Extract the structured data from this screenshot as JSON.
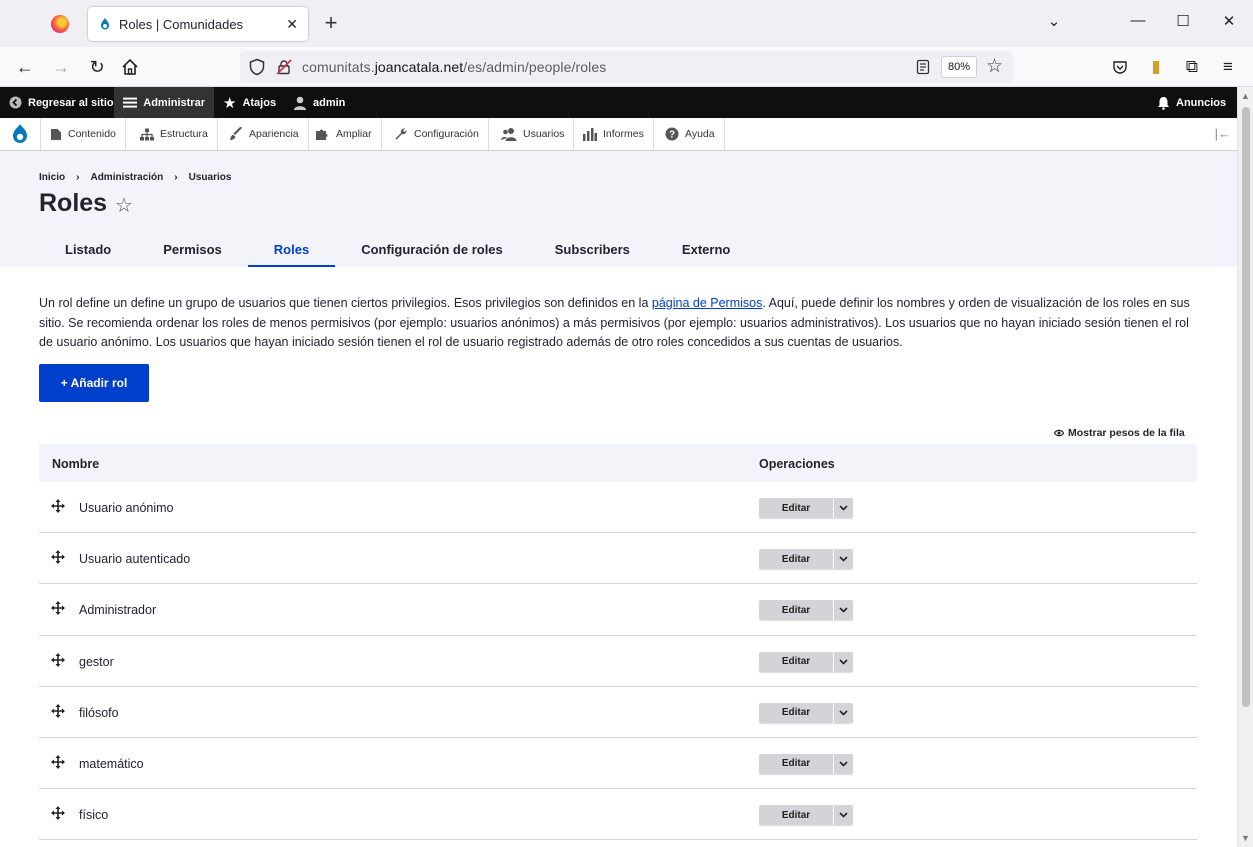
{
  "browser": {
    "tab_title": "Roles | Comunidades",
    "url_prefix": "comunitats.",
    "url_host": "joancatala.net",
    "url_path": "/es/admin/people/roles",
    "zoom": "80%"
  },
  "toolbar": {
    "back_to_site": "Regresar al sitio",
    "manage": "Administrar",
    "shortcuts": "Atajos",
    "user": "admin",
    "announcements": "Anuncios"
  },
  "tray": {
    "items": [
      "Contenido",
      "Estructura",
      "Apariencia",
      "Ampliar",
      "Configuración",
      "Usuarios",
      "Informes",
      "Ayuda"
    ]
  },
  "header": {
    "breadcrumb": [
      "Inicio",
      "Administración",
      "Usuarios"
    ],
    "title": "Roles",
    "tabs": [
      "Listado",
      "Permisos",
      "Roles",
      "Configuración de roles",
      "Subscribers",
      "Externo"
    ],
    "active_tab": "Roles"
  },
  "content": {
    "desc_part1": "Un rol define un define un grupo de usuarios que tienen ciertos privilegios. Esos privilegios son definidos en la ",
    "desc_link": "página de Permisos",
    "desc_part2": ". Aquí, puede definir los nombres y orden de visualización de los roles en sus sitio. Se recomienda ordenar los roles de menos permisivos (por ejemplo: usuarios anónimos) a más permisivos (por ejemplo: usuarios administrativos). Los usuarios que no hayan iniciado sesión tienen el rol de usuario anónimo. Los usuarios que hayan iniciado sesión tienen el rol de usuario registrado además de otro roles concedidos a sus cuentas de usuarios.",
    "add_button": "+ Añadir rol",
    "show_weights": "Mostrar pesos de la fila"
  },
  "table": {
    "columns": [
      "Nombre",
      "Operaciones"
    ],
    "edit_label": "Editar",
    "rows": [
      "Usuario anónimo",
      "Usuario autenticado",
      "Administrador",
      "gestor",
      "filósofo",
      "matemático",
      "físico"
    ]
  },
  "colors": {
    "accent": "#003ecc",
    "toolbar_bg": "#0f0f0f",
    "header_bg": "#f3f4f9"
  }
}
